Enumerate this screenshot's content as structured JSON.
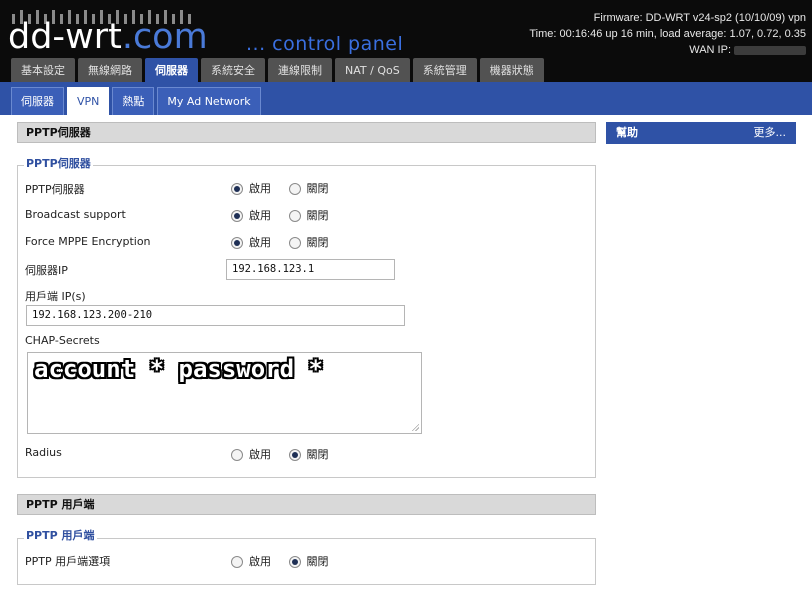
{
  "header": {
    "logo_main": "dd-wrt",
    "logo_suffix": ".com",
    "tagline": "... control panel",
    "firmware": "Firmware: DD-WRT v24-sp2 (10/10/09) vpn",
    "time": "Time: 00:16:46 up 16 min, load average: 1.07, 0.72, 0.35",
    "wan_ip_label": "WAN IP:"
  },
  "tabs": [
    {
      "label": "基本設定",
      "active": false
    },
    {
      "label": "無線網路",
      "active": false
    },
    {
      "label": "伺服器",
      "active": true
    },
    {
      "label": "系統安全",
      "active": false
    },
    {
      "label": "連線限制",
      "active": false
    },
    {
      "label": "NAT / QoS",
      "active": false
    },
    {
      "label": "系統管理",
      "active": false
    },
    {
      "label": "機器狀態",
      "active": false
    }
  ],
  "subtabs": [
    {
      "label": "伺服器",
      "active": false
    },
    {
      "label": "VPN",
      "active": true
    },
    {
      "label": "熱點",
      "active": false
    },
    {
      "label": "My Ad Network",
      "active": false
    }
  ],
  "pptp_server": {
    "section_title": "PPTP伺服器",
    "legend": "PPTP伺服器",
    "enable_label": "PPTP伺服器",
    "enable_value": "enabled",
    "broadcast_label": "Broadcast support",
    "broadcast_value": "enabled",
    "mppe_label": "Force MPPE Encryption",
    "mppe_value": "enabled",
    "server_ip_label": "伺服器IP",
    "server_ip": "192.168.123.1",
    "client_ip_label": "用戶端 IP(s)",
    "client_ip": "192.168.123.200-210",
    "chap_label": "CHAP-Secrets",
    "chap_value": "account * password *",
    "radius_label": "Radius",
    "radius_value": "disabled"
  },
  "pptp_client": {
    "section_title": "PPTP 用戶端",
    "legend": "PPTP 用戶端",
    "option_label": "PPTP 用戶端選項",
    "option_value": "disabled"
  },
  "radio_labels": {
    "enable": "啟用",
    "disable": "關閉"
  },
  "help": {
    "title": "幫助",
    "more": "更多..."
  }
}
